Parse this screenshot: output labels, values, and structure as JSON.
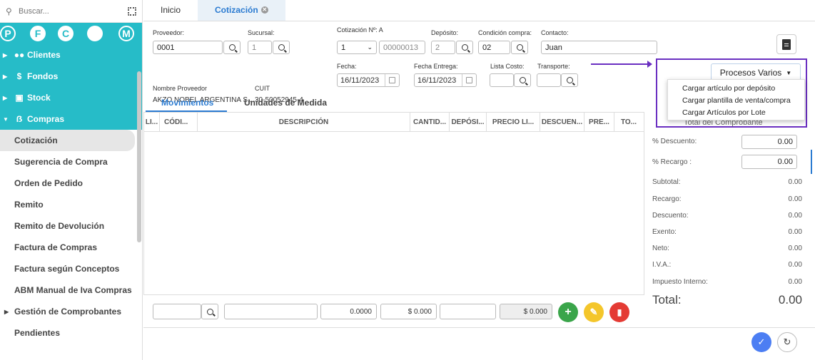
{
  "sidebar": {
    "search_placeholder": "Buscar...",
    "circles": [
      "P",
      "F",
      "C",
      "",
      "M"
    ],
    "sections": [
      {
        "label": "Clientes",
        "icon": "users-icon"
      },
      {
        "label": "Fondos",
        "icon": "dollar-icon"
      },
      {
        "label": "Stock",
        "icon": "box-icon"
      },
      {
        "label": "Compras",
        "icon": "cart-icon"
      }
    ],
    "items": [
      "Cotización",
      "Sugerencia de Compra",
      "Orden de Pedido",
      "Remito",
      "Remito de Devolución",
      "Factura de Compras",
      "Factura según Conceptos",
      "ABM Manual de Iva Compras",
      "Gestión de Comprobantes",
      "Pendientes"
    ]
  },
  "tabs": {
    "inicio": "Inicio",
    "cotizacion": "Cotización"
  },
  "form": {
    "proveedor_label": "Proveedor:",
    "proveedor_value": "0001",
    "sucursal_label": "Sucursal:",
    "sucursal_value": "1",
    "cotizacion_label": "Cotización Nº: A",
    "cotizacion_letter": "1",
    "cotizacion_number": "00000013",
    "deposito_label": "Depósito:",
    "deposito_value": "2",
    "condicion_label": "Condición compra:",
    "condicion_value": "02",
    "contacto_label": "Contacto:",
    "contacto_value": "Juan",
    "nombre_label": "Nombre Proveedor",
    "nombre_value": "AKZO NOBEL ARGENTINA S...",
    "cuit_label": "CUIT",
    "cuit_value": "30-50052945-4",
    "fecha_label": "Fecha:",
    "fecha_value": "16/11/2023",
    "fecha_entrega_label": "Fecha Entrega:",
    "fecha_entrega_value": "16/11/2023",
    "lista_costo_label": "Lista Costo:",
    "transporte_label": "Transporte:"
  },
  "procesos": {
    "button_label": "Procesos Varios",
    "menu": [
      "Cargar artículo por depósito",
      "Cargar plantilla de venta/compra",
      "Cargar Artículos por Lote"
    ],
    "hidden_header": "Total del Comprobante"
  },
  "subtabs": {
    "movimientos": "Movimientos",
    "unidades": "Unidades de Medida"
  },
  "grid": {
    "columns": [
      "LI...",
      "CÓDI...",
      "DESCRIPCIÓN",
      "CANTID...",
      "DEPÓSI...",
      "PRECIO LI...",
      "DESCUEN...",
      "PRE...",
      "TO..."
    ]
  },
  "bottom_row": {
    "qty": "0.0000",
    "price": "$ 0.000",
    "total": "$ 0.000"
  },
  "totals": {
    "descuento_pct_label": "% Descuento:",
    "descuento_pct_value": "0.00",
    "recargo_pct_label": "% Recargo :",
    "recargo_pct_value": "0.00",
    "rows": [
      {
        "label": "Subtotal:",
        "value": "0.00"
      },
      {
        "label": "Recargo:",
        "value": "0.00"
      },
      {
        "label": "Descuento:",
        "value": "0.00"
      },
      {
        "label": "Exento:",
        "value": "0.00"
      },
      {
        "label": "Neto:",
        "value": "0.00"
      },
      {
        "label": "I.V.A.:",
        "value": "0.00"
      },
      {
        "label": "Impuesto Interno:",
        "value": "0.00"
      }
    ],
    "total_label": "Total:",
    "total_value": "0.00"
  },
  "colors": {
    "teal": "#26bcc8",
    "blue": "#2b7bd1",
    "purple": "#6a2fc1",
    "green": "#3aa54a",
    "yellow": "#f4c62b",
    "red": "#e43b34"
  }
}
